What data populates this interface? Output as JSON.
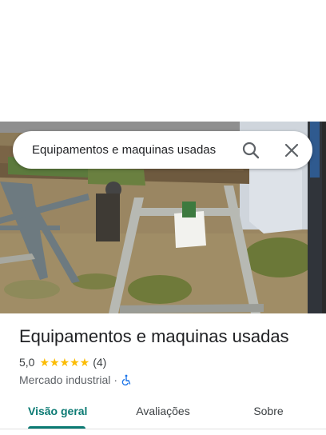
{
  "search": {
    "query": "Equipamentos e maquinas usadas",
    "search_icon": "search-icon",
    "close_icon": "close-icon"
  },
  "photo": {
    "description_icon": "place-photo"
  },
  "place": {
    "title": "Equipamentos e maquinas usadas",
    "rating": "5,0",
    "stars": "★★★★★",
    "review_count": "(4)",
    "category": "Mercado industrial",
    "separator": "·",
    "accessibility_icon": "wheelchair-icon"
  },
  "tabs": [
    {
      "label": "Visão geral",
      "active": true
    },
    {
      "label": "Avaliações",
      "active": false
    },
    {
      "label": "Sobre",
      "active": false
    }
  ],
  "colors": {
    "accent": "#0b7a73",
    "star": "#fbbc04",
    "accessibility": "#1a73e8"
  }
}
